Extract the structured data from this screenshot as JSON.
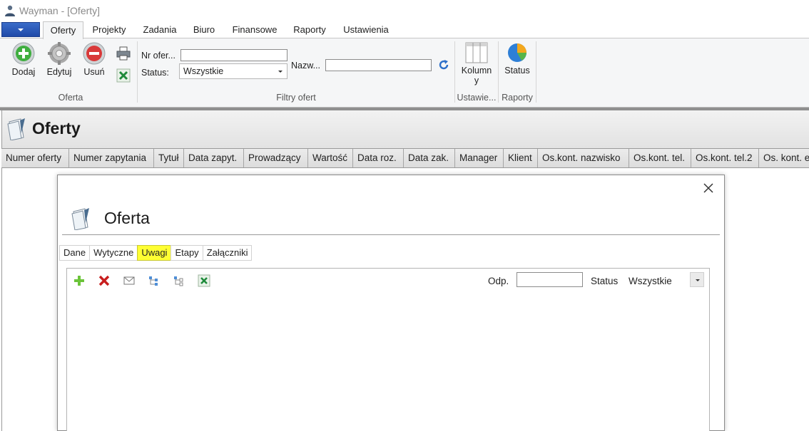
{
  "window": {
    "title": "Wayman - [Oferty]"
  },
  "ribbon_tabs": [
    {
      "label": "Oferty",
      "active": true
    },
    {
      "label": "Projekty"
    },
    {
      "label": "Zadania"
    },
    {
      "label": "Biuro"
    },
    {
      "label": "Finansowe"
    },
    {
      "label": "Raporty"
    },
    {
      "label": "Ustawienia"
    }
  ],
  "ribbon": {
    "oferta_group": {
      "label": "Oferta",
      "add_label": "Dodaj",
      "edit_label": "Edytuj",
      "delete_label": "Usuń"
    },
    "filters_group": {
      "label": "Filtry ofert",
      "nr_label": "Nr ofer...",
      "nr_value": "",
      "status_label": "Status:",
      "status_value": "Wszystkie",
      "name_label": "Nazw...",
      "name_value": ""
    },
    "settings_group": {
      "label": "Ustawie...",
      "columns_label": "Kolumn y"
    },
    "reports_group": {
      "label": "Raporty",
      "status_label": "Status"
    }
  },
  "page": {
    "title": "Oferty"
  },
  "grid": {
    "columns": [
      "Numer oferty",
      "Numer zapytania",
      "Tytuł",
      "Data zapyt.",
      "Prowadzący",
      "Wartość",
      "Data roz.",
      "Data zak.",
      "Manager",
      "Klient",
      "Os.kont. nazwisko",
      "Os.kont. tel.",
      "Os.kont. tel.2",
      "Os. kont. e"
    ]
  },
  "dialog": {
    "title": "Oferta",
    "tabs": [
      {
        "label": "Dane"
      },
      {
        "label": "Wytyczne"
      },
      {
        "label": "Uwagi",
        "active": true
      },
      {
        "label": "Etapy"
      },
      {
        "label": "Załączniki"
      }
    ],
    "notes": {
      "odp_label": "Odp.",
      "odp_value": "",
      "status_label": "Status",
      "status_value": "Wszystkie"
    }
  },
  "colors": {
    "active_tab_highlight": "#ffff33",
    "app_button": "#1f4aa8",
    "add_green": "#2e9e2e",
    "delete_red": "#c81e1e"
  }
}
